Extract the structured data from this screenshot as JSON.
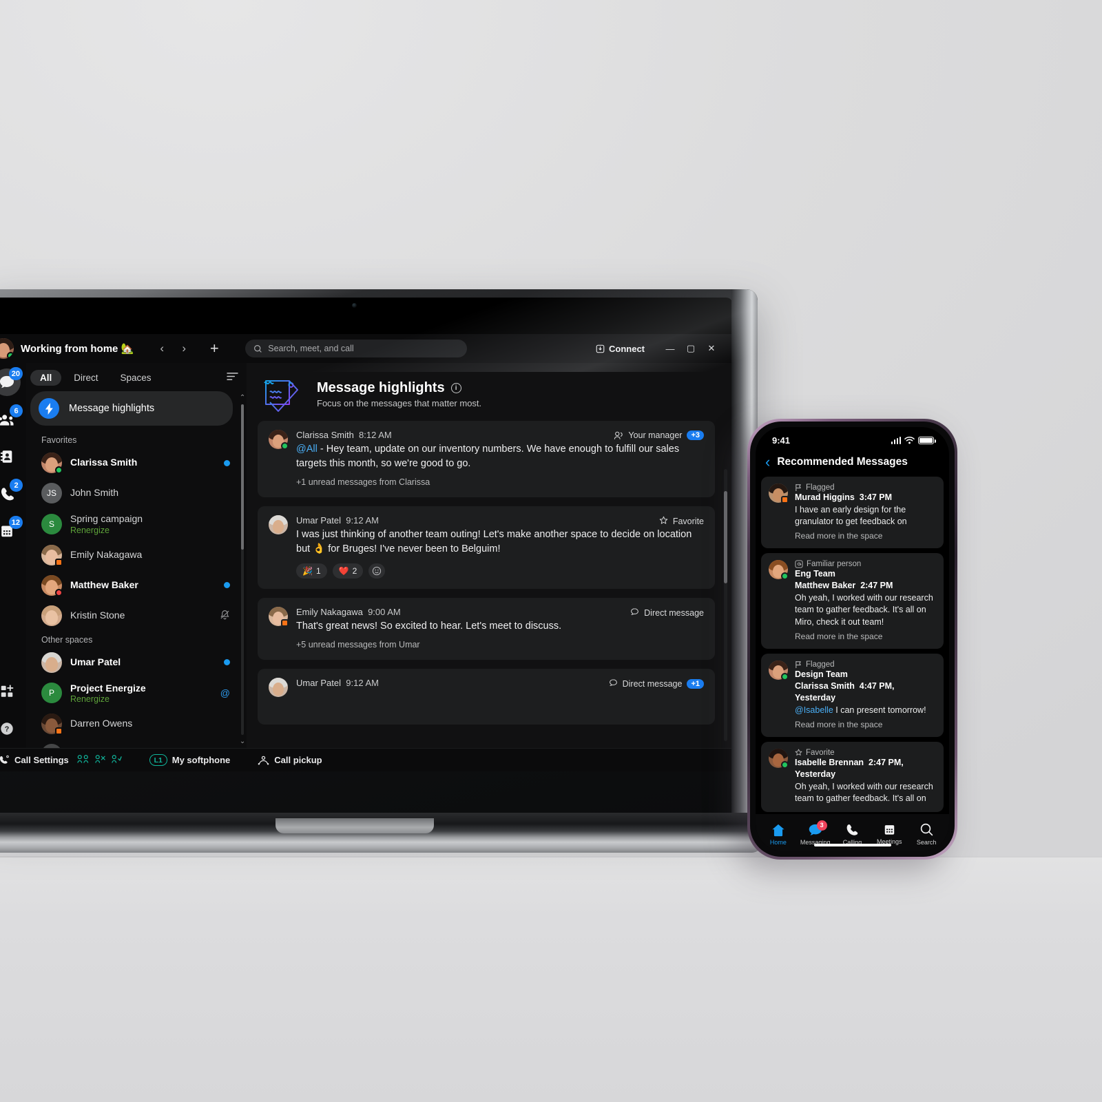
{
  "desktop": {
    "titlebar": {
      "status_text": "Working from home 🏡",
      "back_icon": "‹",
      "forward_icon": "›",
      "add_icon": "+",
      "search_placeholder": "Search, meet, and call",
      "search_icon": "search-icon",
      "connect_label": "Connect",
      "minimize": "—",
      "maximize": "▢",
      "close": "✕"
    },
    "rail": [
      {
        "name": "messaging",
        "badge": "20",
        "active": true
      },
      {
        "name": "teams",
        "badge": "6",
        "active": false
      },
      {
        "name": "contacts",
        "badge": "",
        "active": false
      },
      {
        "name": "calling",
        "badge": "2",
        "active": false
      },
      {
        "name": "meetings",
        "badge": "12",
        "active": false
      },
      {
        "name": "apps",
        "badge": "",
        "active": false
      },
      {
        "name": "help",
        "badge": "",
        "active": false
      }
    ],
    "filters": {
      "all": "All",
      "direct": "Direct",
      "spaces": "Spaces",
      "filter_icon": "filter-icon"
    },
    "highlights_item": "Message highlights",
    "sections": [
      {
        "label": "Favorites",
        "items": [
          {
            "name": "Clarissa Smith",
            "sub": "",
            "bold": true,
            "right": "dot",
            "presence": "available",
            "avatar": "photo-clarissa"
          },
          {
            "name": "John Smith",
            "sub": "",
            "bold": false,
            "right": "",
            "presence": "",
            "avatar": "initials",
            "initials": "JS"
          },
          {
            "name": "Spring campaign",
            "sub": "Renergize",
            "bold": false,
            "right": "",
            "presence": "",
            "avatar": "initials-green",
            "initials": "S"
          },
          {
            "name": "Emily Nakagawa",
            "sub": "",
            "bold": false,
            "right": "",
            "presence": "call",
            "avatar": "photo-emily"
          },
          {
            "name": "Matthew Baker",
            "sub": "",
            "bold": true,
            "right": "dot",
            "presence": "dnd",
            "avatar": "photo-matthew"
          },
          {
            "name": "Kristin Stone",
            "sub": "",
            "bold": false,
            "right": "mute",
            "presence": "",
            "avatar": "photo-kristin"
          }
        ]
      },
      {
        "label": "Other spaces",
        "items": [
          {
            "name": "Umar Patel",
            "sub": "",
            "bold": true,
            "right": "dot",
            "presence": "away",
            "avatar": "photo-umar"
          },
          {
            "name": "Project Energize",
            "sub": "Renergize",
            "bold": true,
            "right": "at",
            "presence": "",
            "avatar": "initials-green",
            "initials": "P"
          },
          {
            "name": "Darren Owens",
            "sub": "",
            "bold": false,
            "right": "",
            "presence": "call",
            "avatar": "photo-darren"
          }
        ]
      }
    ],
    "main": {
      "title": "Message highlights",
      "subtitle": "Focus on the messages that matter most.",
      "info_icon": "info-icon",
      "header_icon": "highlights-note-icon",
      "cards": [
        {
          "author": "Clarissa Smith",
          "time": "8:12 AM",
          "mention": "@All",
          "text": " - Hey team, update on our inventory numbers. We have enough to fulfill our sales targets this month, so we're good to go.",
          "unread": "+1 unread messages from Clarissa",
          "tag_icon": "manager-icon",
          "tag": "Your manager",
          "tag_pill": "+3",
          "reactions": [],
          "avatar": "photo-clarissa",
          "presence": "available"
        },
        {
          "author": "Umar Patel",
          "time": "9:12 AM",
          "mention": "",
          "text": "I was just thinking of another team outing! Let's make another space to decide on location but 👌 for Bruges! I've never been to Belguim!",
          "unread": "",
          "tag_icon": "star-icon",
          "tag": "Favorite",
          "tag_pill": "",
          "reactions": [
            {
              "emoji": "🎉",
              "count": "1"
            },
            {
              "emoji": "❤️",
              "count": "2"
            },
            {
              "emoji": "add-reaction-icon",
              "count": ""
            }
          ],
          "avatar": "photo-umar",
          "presence": "away"
        },
        {
          "author": "Emily Nakagawa",
          "time": "9:00 AM",
          "mention": "",
          "text": "That's great news! So excited to hear. Let's meet to discuss.",
          "unread": "+5 unread messages from Umar",
          "tag_icon": "chat-bubble-icon",
          "tag": "Direct message",
          "tag_pill": "",
          "reactions": [],
          "avatar": "photo-emily",
          "presence": "call"
        },
        {
          "author": "Umar Patel",
          "time": "9:12 AM",
          "mention": "",
          "text": "",
          "unread": "",
          "tag_icon": "chat-bubble-icon",
          "tag": "Direct message",
          "tag_pill": "+1",
          "reactions": [],
          "avatar": "photo-umar",
          "presence": "away"
        }
      ]
    },
    "bottombar": {
      "call_settings": "Call Settings",
      "call_settings_icon": "call-settings-icon",
      "teal_icons": [
        "call-forward-icon",
        "do-not-disturb-icon",
        "call-waiting-icon"
      ],
      "line_label": "L1",
      "softphone": "My softphone",
      "call_pickup": "Call pickup",
      "call_pickup_icon": "call-pickup-icon"
    }
  },
  "phone": {
    "status": {
      "time": "9:41",
      "signal_icon": "cellular-bars-icon",
      "wifi_icon": "wifi-icon",
      "battery_icon": "battery-icon"
    },
    "header": {
      "back_icon": "‹",
      "title": "Recommended Messages"
    },
    "cards": [
      {
        "tag_icon": "flag-icon",
        "tag": "Flagged",
        "space": "",
        "author": "Murad Higgins",
        "time": "3:47 PM",
        "mention": "",
        "text": "I have an early design for the granulator to get feedback on",
        "more": "Read more in the space",
        "avatar": "photo-murad",
        "presence": "call"
      },
      {
        "tag_icon": "at-icon",
        "tag": "Familiar person",
        "space": "Eng Team",
        "author": "Matthew Baker",
        "time": "2:47 PM",
        "mention": "",
        "text": "Oh yeah, I worked with our research team to gather feedback. It's all on Miro, check it out team!",
        "more": "Read more in the space",
        "avatar": "photo-matthew",
        "presence": "available"
      },
      {
        "tag_icon": "flag-icon",
        "tag": "Flagged",
        "space": "Design Team",
        "author": "Clarissa Smith",
        "time": "4:47 PM, Yesterday",
        "mention": "@Isabelle",
        "text": " I can present tomorrow!",
        "more": "Read more in the space",
        "avatar": "photo-clarissa",
        "presence": "available"
      },
      {
        "tag_icon": "star-icon",
        "tag": "Favorite",
        "space": "",
        "author": "Isabelle Brennan",
        "time": "2:47 PM, Yesterday",
        "mention": "",
        "text": "Oh yeah, I worked with our research team to gather feedback. It's all on",
        "more": "",
        "avatar": "photo-isabelle",
        "presence": "available"
      }
    ],
    "tabs": [
      {
        "label": "Home",
        "icon": "home-icon",
        "badge": "",
        "active": true
      },
      {
        "label": "Messaging",
        "icon": "message-icon",
        "badge": "3",
        "active": false
      },
      {
        "label": "Calling",
        "icon": "phone-icon",
        "badge": "",
        "active": false
      },
      {
        "label": "Meetings",
        "icon": "calendar-icon",
        "badge": "",
        "active": false
      },
      {
        "label": "Search",
        "icon": "search-icon",
        "badge": "",
        "active": false
      }
    ]
  },
  "colors": {
    "accent": "#1a7df0",
    "phone_accent": "#1a9bf0",
    "green": "#5ea33a",
    "teal": "#10b59b",
    "badge_red": "#f0435c"
  }
}
